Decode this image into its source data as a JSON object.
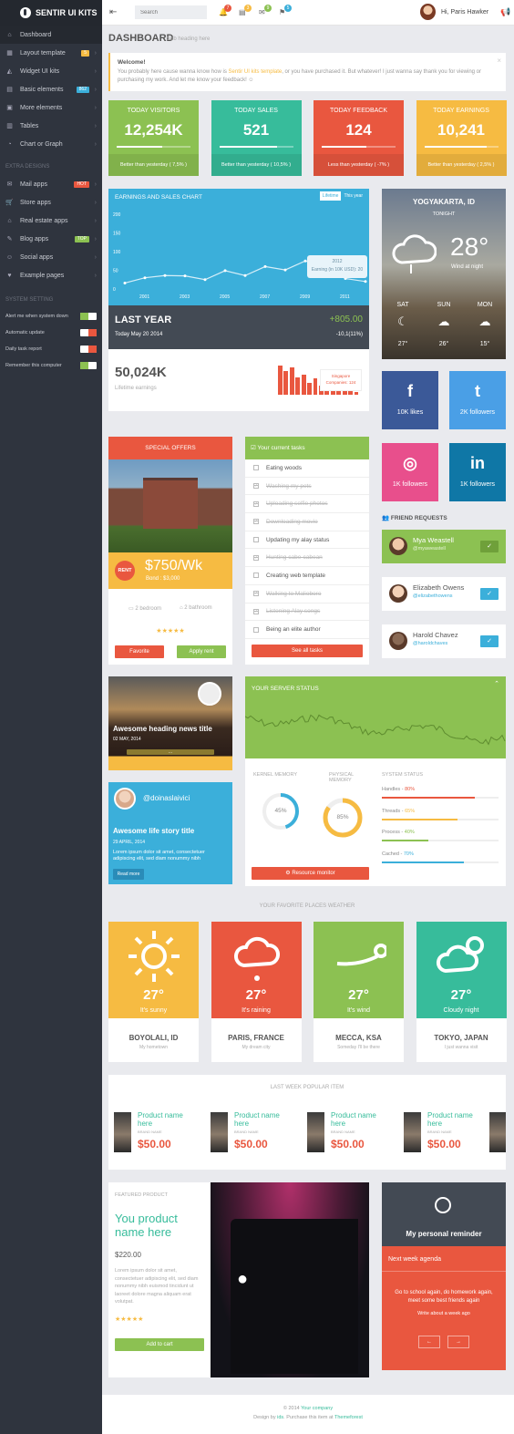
{
  "brand": {
    "name": "SENTIR UI KITS"
  },
  "sidebar": {
    "items": [
      {
        "label": "Dashboard",
        "icon": "home-icon"
      },
      {
        "label": "Layout template",
        "icon": "layout-icon",
        "badge": "5",
        "badge_color": "#f6bb42"
      },
      {
        "label": "Widget UI kits",
        "icon": "widget-icon"
      },
      {
        "label": "Basic elements",
        "icon": "elements-icon",
        "badge": "862",
        "badge_color": "#3bafda"
      },
      {
        "label": "More elements",
        "icon": "more-icon"
      },
      {
        "label": "Tables",
        "icon": "table-icon"
      },
      {
        "label": "Chart or Graph",
        "icon": "chart-icon"
      }
    ],
    "extra_title": "EXTRA DESIGNS",
    "extra": [
      {
        "label": "Mail apps",
        "icon": "mail-icon",
        "badge": "HOT",
        "badge_color": "#e9573f"
      },
      {
        "label": "Store apps",
        "icon": "store-icon"
      },
      {
        "label": "Real estate apps",
        "icon": "house-icon"
      },
      {
        "label": "Blog apps",
        "icon": "blog-icon",
        "badge": "TOP",
        "badge_color": "#8cc152"
      },
      {
        "label": "Social apps",
        "icon": "social-icon"
      },
      {
        "label": "Example pages",
        "icon": "heart-icon"
      }
    ],
    "settings_title": "SYSTEM SETTING",
    "settings": [
      {
        "label": "Alert me when system down",
        "on": true
      },
      {
        "label": "Automatic update",
        "on": false
      },
      {
        "label": "Daily task report",
        "on": false
      },
      {
        "label": "Remember this computer",
        "on": true
      }
    ]
  },
  "topbar": {
    "search_placeholder": "Search",
    "user": "Hi, Paris Hawker",
    "notif": [
      {
        "count": "7",
        "color": "#e9573f"
      },
      {
        "count": "3",
        "color": "#f6bb42"
      },
      {
        "count": "9",
        "color": "#8cc152"
      },
      {
        "count": "5",
        "color": "#3bafda"
      }
    ]
  },
  "page": {
    "title": "DASHBOARD",
    "subtitle": "Sub heading here"
  },
  "alert": {
    "title": "Welcome!",
    "text_a": "You probably here cause wanna know how is ",
    "link": "Sentir UI kits template",
    "text_b": ", or you have purchased it. But whatever! I just wanna say thank you for viewing or purchasing my work. And let me know your feedback! ☺"
  },
  "stats": [
    {
      "title": "TODAY VISITORS",
      "value": "12,254K",
      "progress": 0.62,
      "foot": "Better than yesterday ( 7,5% )",
      "color": "#8cc152"
    },
    {
      "title": "TODAY SALES",
      "value": "521",
      "progress": 0.79,
      "foot": "Better than yesterday ( 10,5% )",
      "color": "#37bc9b"
    },
    {
      "title": "TODAY FEEDBACK",
      "value": "124",
      "progress": 0.6,
      "foot": "Less than yesterday ( -7% )",
      "color": "#e9573f"
    },
    {
      "title": "TODAY EARNINGS",
      "value": "10,241",
      "progress": 0.85,
      "foot": "Better than yesterday ( 2,5% )",
      "color": "#f6bb42"
    }
  ],
  "earnings": {
    "title": "EARNINGS AND SALES CHART",
    "tabs": [
      "Lifetime",
      "This year"
    ],
    "summary": "LAST YEAR",
    "amount": "+805.00",
    "date": "Today May 20 2014",
    "delta": "-10,1(11%)",
    "tooltip_year": "2012",
    "tooltip_text": "Earning (in 10K USD): 20"
  },
  "chart_data": {
    "type": "line",
    "x": [
      2000,
      2001,
      2002,
      2003,
      2004,
      2005,
      2006,
      2007,
      2008,
      2009,
      2010,
      2011,
      2012
    ],
    "values": [
      16,
      30,
      36,
      35,
      25,
      49,
      36,
      60,
      51,
      75,
      65,
      28,
      20
    ],
    "xticks": [
      "2001",
      "2003",
      "2005",
      "2007",
      "2009",
      "2011"
    ],
    "yticks": [
      "200",
      "150",
      "100",
      "50",
      "0"
    ],
    "ylim": [
      0,
      200
    ]
  },
  "lifetime": {
    "value": "50,024K",
    "label": "Lifetime earnings",
    "tooltip_title": "Singapore",
    "tooltip_text": "Companies: 124",
    "bars": [
      100,
      80,
      95,
      60,
      70,
      40,
      55,
      30,
      20,
      35,
      25,
      15,
      20,
      10
    ]
  },
  "weather_city": {
    "city": "YOGYAKARTA, ID",
    "when": "TONIGHT",
    "temp": "28°",
    "desc": "Wind at night",
    "days": [
      {
        "d": "SAT",
        "t": "27°",
        "icon": "moon-icon"
      },
      {
        "d": "SUN",
        "t": "26°",
        "icon": "cloud-icon"
      },
      {
        "d": "MON",
        "t": "15°",
        "icon": "cloud-icon"
      }
    ]
  },
  "socials": [
    {
      "glyph": "f",
      "label": "10K likes",
      "color": "#3b5998",
      "icon": "facebook-icon"
    },
    {
      "glyph": "t",
      "label": "2K followers",
      "color": "#4a9fe6",
      "icon": "twitter-icon"
    },
    {
      "glyph": "◎",
      "label": "1K followers",
      "color": "#e84f8c",
      "icon": "dribbble-icon"
    },
    {
      "glyph": "in",
      "label": "1K followers",
      "color": "#0f77a6",
      "icon": "linkedin-icon"
    }
  ],
  "offers": {
    "title": "SPECIAL OFFERS",
    "tag": "RENT",
    "price": "$750/Wk",
    "bond": "Bond : $3,000",
    "bed": "2 bedroom",
    "bath": "2 bathroom",
    "stars": "★★★★★",
    "favorite": "Favorite",
    "apply": "Apply rent"
  },
  "tasks": {
    "title": "Your current tasks",
    "items": [
      {
        "label": "Eating woods",
        "done": false
      },
      {
        "label": "Washing my pets",
        "done": true
      },
      {
        "label": "Uploading selfie photos",
        "done": true
      },
      {
        "label": "Downloading movie",
        "done": true
      },
      {
        "label": "Updating my alay status",
        "done": false
      },
      {
        "label": "Hunting cabe-cabean",
        "done": true
      },
      {
        "label": "Creating web template",
        "done": false
      },
      {
        "label": "Walking to Malioboro",
        "done": true
      },
      {
        "label": "Listening Alay songs",
        "done": true
      },
      {
        "label": "Being an elite author",
        "done": false
      }
    ],
    "button": "See all tasks"
  },
  "friends": {
    "title": "FRIEND REQUESTS",
    "list": [
      {
        "name": "Mya Weastell",
        "handle": "@myaweastell",
        "active": true
      },
      {
        "name": "Elizabeth Owens",
        "handle": "@elizabethowens",
        "active": false
      },
      {
        "name": "Harold Chavez",
        "handle": "@haroldchaves",
        "active": false
      }
    ]
  },
  "news": {
    "title": "Awesome heading news title",
    "date": "02 MAY, 2014",
    "more": "..."
  },
  "story": {
    "handle": "@doinaslaivici",
    "title": "Awesome life story title",
    "date": "29 APRIL, 2014",
    "text": "Lorem ipsum dolor sit amet, consectetuer adipiscing elit, sed diam nonummy nibh",
    "button": "Read more"
  },
  "server": {
    "title": "YOUR SERVER STATUS",
    "kernel": "KERNEL MEMORY",
    "kernel_val": "45%",
    "kernel_pct": 0.45,
    "physical": "PHYSICAL MEMORY",
    "physical_val": "85%",
    "physical_pct": 0.85,
    "system": "SYSTEM STATUS",
    "bars": [
      {
        "label": "Handles - ",
        "val": "80%",
        "pct": 0.8,
        "color": "#e9573f"
      },
      {
        "label": "Threads - ",
        "val": "65%",
        "pct": 0.65,
        "color": "#f6bb42"
      },
      {
        "label": "Process - ",
        "val": "40%",
        "pct": 0.4,
        "color": "#8cc152"
      },
      {
        "label": "Cached - ",
        "val": "70%",
        "pct": 0.7,
        "color": "#3bafda"
      }
    ],
    "button": "Resource monitor"
  },
  "places": {
    "title": "YOUR FAVORITE PLACES WEATHER",
    "list": [
      {
        "temp": "27°",
        "cond": "It's sunny",
        "city": "BOYOLALI, ID",
        "sub": "My hometown",
        "color": "#f6bb42",
        "icon": "sun-icon"
      },
      {
        "temp": "27°",
        "cond": "It's raining",
        "city": "PARIS, FRANCE",
        "sub": "My dream city",
        "color": "#e9573f",
        "icon": "rain-icon"
      },
      {
        "temp": "27°",
        "cond": "It's wind",
        "city": "MECCA, KSA",
        "sub": "Someday I'll be there",
        "color": "#8cc152",
        "icon": "wind-icon"
      },
      {
        "temp": "27°",
        "cond": "Cloudy night",
        "city": "TOKYO, JAPAN",
        "sub": "I just wanna visit",
        "color": "#37bc9b",
        "icon": "cloud-night-icon"
      }
    ]
  },
  "popular": {
    "title": "LAST WEEK POPULAR ITEM",
    "items": [
      {
        "name": "Product name here",
        "brand": "BRAND NAME",
        "price": "$50.00"
      },
      {
        "name": "Product name here",
        "brand": "BRAND NAME",
        "price": "$50.00"
      },
      {
        "name": "Product name here",
        "brand": "BRAND NAME",
        "price": "$50.00"
      },
      {
        "name": "Product name here",
        "brand": "BRAND NAME",
        "price": "$50.00"
      }
    ]
  },
  "featured": {
    "label": "FEATURED PRODUCT",
    "title": "You product name here",
    "price": "$220.00",
    "text": "Lorem ipsum dolor sit amet, consectetuer adipiscing elit, sed diam nonummy nibh euismod tincidunt ut laoreet dolore magna aliquam erat volutpat.",
    "stars": "★★★★★",
    "button": "Add to cart"
  },
  "reminder": {
    "title": "My personal reminder",
    "agenda": "Next week agenda",
    "text": "Go to school again, do homework again, meet some best friends again",
    "sub": "Write about a week ago"
  },
  "footer": {
    "line1_a": "© 2014 ",
    "line1_link": "Your company",
    "line2_a": "Design by ",
    "line2_by": "ids",
    "line2_b": ". Purchase this item at ",
    "line2_link": "Themeforest"
  }
}
